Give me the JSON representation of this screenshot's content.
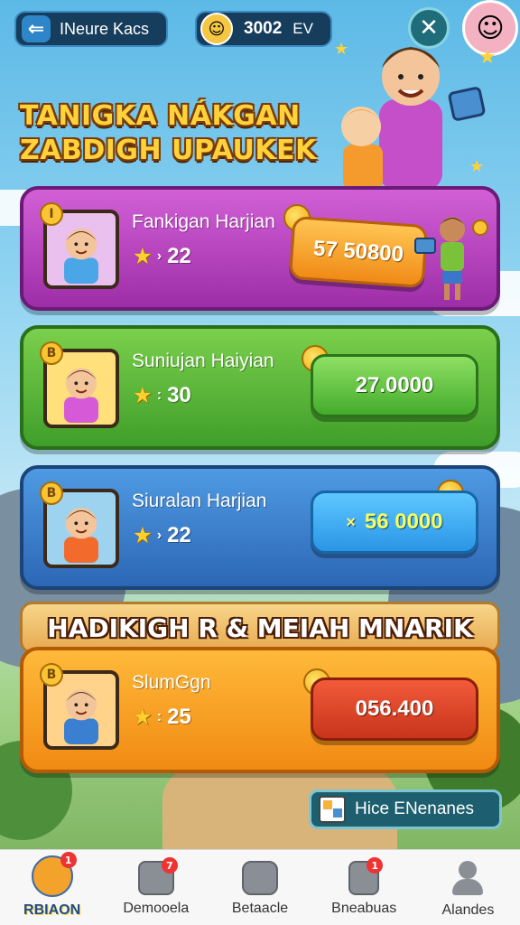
{
  "header": {
    "back_label": "INeure Kacs",
    "currency_value": "3002",
    "currency_unit": "EV",
    "back_icon": "arrow-left-icon",
    "close_icon": "close-icon"
  },
  "title": {
    "line1": "TANIGKA NÁKGAN",
    "line2": "ZABDIGH UPAUKEK"
  },
  "cards": [
    {
      "name": "Fankigan Harjian",
      "badge": "I",
      "stars": "22",
      "reward": "57 50800",
      "reward_prefix": ""
    },
    {
      "name": "Suniujan Haiyian",
      "badge": "B",
      "stars": "30",
      "reward": "27.0000",
      "reward_prefix": ""
    },
    {
      "name": "Siuralan Harjian",
      "badge": "B",
      "stars": "22",
      "reward": "56 0000",
      "reward_prefix": "×"
    },
    {
      "name": "SlumGgn",
      "badge": "B",
      "stars": "25",
      "reward": "056.400",
      "reward_prefix": ""
    }
  ],
  "section_banner": "HADIKIGH R & MEIAH MNARIK",
  "hint_button": "Hice ENenanes",
  "nav": [
    {
      "label": "RBIAON",
      "icon": "avatar-icon",
      "badge": "1",
      "active": true
    },
    {
      "label": "Demooela",
      "icon": "inbox-icon",
      "badge": "7",
      "active": false
    },
    {
      "label": "Betaacle",
      "icon": "tv-icon",
      "badge": "",
      "active": false
    },
    {
      "label": "Bneabuas",
      "icon": "calculator-icon",
      "badge": "1",
      "active": false
    },
    {
      "label": "Alandes",
      "icon": "person-icon",
      "badge": "",
      "active": false
    }
  ],
  "colors": {
    "card_purple": "#b03fbb",
    "card_green": "#5bb93a",
    "card_blue": "#3b7fcf",
    "card_orange": "#f6a024",
    "title_yellow": "#ffd23a"
  }
}
